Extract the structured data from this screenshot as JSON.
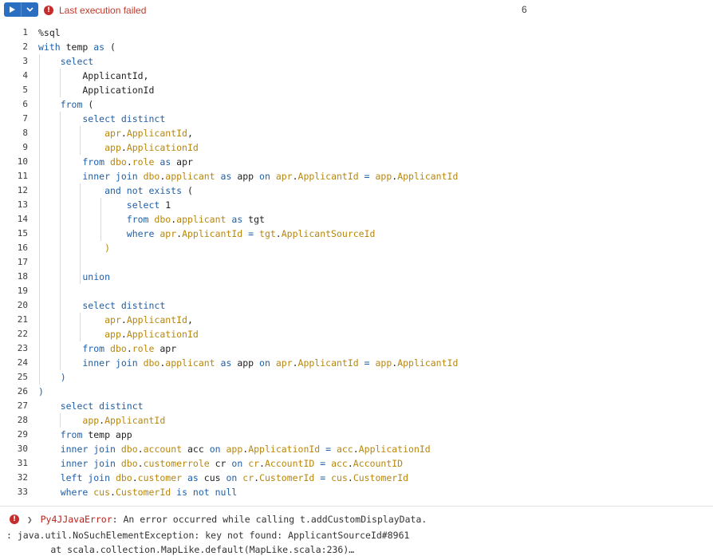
{
  "toolbar": {
    "status_text": "Last execution failed",
    "cell_number": "6"
  },
  "code_lines": [
    [
      {
        "t": "%sql",
        "c": ""
      }
    ],
    [
      {
        "t": "with",
        "c": "kw"
      },
      {
        "t": " temp ",
        "c": ""
      },
      {
        "t": "as",
        "c": "kw"
      },
      {
        "t": " (",
        "c": ""
      }
    ],
    [
      {
        "t": "    select",
        "c": "kw"
      }
    ],
    [
      {
        "t": "        ApplicantId,",
        "c": ""
      }
    ],
    [
      {
        "t": "        ApplicationId",
        "c": ""
      }
    ],
    [
      {
        "t": "    from",
        "c": "kw"
      },
      {
        "t": " (",
        "c": ""
      }
    ],
    [
      {
        "t": "        select distinct",
        "c": "kw"
      }
    ],
    [
      {
        "t": "            ",
        "c": ""
      },
      {
        "t": "apr",
        "c": "id"
      },
      {
        "t": ".",
        "c": ""
      },
      {
        "t": "ApplicantId",
        "c": "id"
      },
      {
        "t": ",",
        "c": ""
      }
    ],
    [
      {
        "t": "            ",
        "c": ""
      },
      {
        "t": "app",
        "c": "id"
      },
      {
        "t": ".",
        "c": ""
      },
      {
        "t": "ApplicationId",
        "c": "id"
      }
    ],
    [
      {
        "t": "        from",
        "c": "kw"
      },
      {
        "t": " ",
        "c": ""
      },
      {
        "t": "dbo",
        "c": "id"
      },
      {
        "t": ".",
        "c": ""
      },
      {
        "t": "role",
        "c": "id"
      },
      {
        "t": " ",
        "c": ""
      },
      {
        "t": "as",
        "c": "kw"
      },
      {
        "t": " apr",
        "c": ""
      }
    ],
    [
      {
        "t": "        inner join",
        "c": "kw"
      },
      {
        "t": " ",
        "c": ""
      },
      {
        "t": "dbo",
        "c": "id"
      },
      {
        "t": ".",
        "c": ""
      },
      {
        "t": "applicant",
        "c": "id"
      },
      {
        "t": " ",
        "c": ""
      },
      {
        "t": "as",
        "c": "kw"
      },
      {
        "t": " app ",
        "c": ""
      },
      {
        "t": "on",
        "c": "kw"
      },
      {
        "t": " ",
        "c": ""
      },
      {
        "t": "apr",
        "c": "id"
      },
      {
        "t": ".",
        "c": ""
      },
      {
        "t": "ApplicantId",
        "c": "id"
      },
      {
        "t": " = ",
        "c": "op"
      },
      {
        "t": "app",
        "c": "id"
      },
      {
        "t": ".",
        "c": ""
      },
      {
        "t": "ApplicantId",
        "c": "id"
      }
    ],
    [
      {
        "t": "            and not exists",
        "c": "kw"
      },
      {
        "t": " (",
        "c": ""
      }
    ],
    [
      {
        "t": "                select",
        "c": "kw"
      },
      {
        "t": " 1",
        "c": ""
      }
    ],
    [
      {
        "t": "                from",
        "c": "kw"
      },
      {
        "t": " ",
        "c": ""
      },
      {
        "t": "dbo",
        "c": "id"
      },
      {
        "t": ".",
        "c": ""
      },
      {
        "t": "applicant",
        "c": "id"
      },
      {
        "t": " ",
        "c": ""
      },
      {
        "t": "as",
        "c": "kw"
      },
      {
        "t": " tgt",
        "c": ""
      }
    ],
    [
      {
        "t": "                where",
        "c": "kw"
      },
      {
        "t": " ",
        "c": ""
      },
      {
        "t": "apr",
        "c": "id"
      },
      {
        "t": ".",
        "c": ""
      },
      {
        "t": "ApplicantId",
        "c": "id"
      },
      {
        "t": " = ",
        "c": "op"
      },
      {
        "t": "tgt",
        "c": "id"
      },
      {
        "t": ".",
        "c": ""
      },
      {
        "t": "ApplicantSourceId",
        "c": "id"
      }
    ],
    [
      {
        "t": "            )",
        "c": "id"
      }
    ],
    [],
    [
      {
        "t": "        union",
        "c": "kw"
      }
    ],
    [],
    [
      {
        "t": "        select distinct",
        "c": "kw"
      }
    ],
    [
      {
        "t": "            ",
        "c": ""
      },
      {
        "t": "apr",
        "c": "id"
      },
      {
        "t": ".",
        "c": ""
      },
      {
        "t": "ApplicantId",
        "c": "id"
      },
      {
        "t": ",",
        "c": ""
      }
    ],
    [
      {
        "t": "            ",
        "c": ""
      },
      {
        "t": "app",
        "c": "id"
      },
      {
        "t": ".",
        "c": ""
      },
      {
        "t": "ApplicationId",
        "c": "id"
      }
    ],
    [
      {
        "t": "        from",
        "c": "kw"
      },
      {
        "t": " ",
        "c": ""
      },
      {
        "t": "dbo",
        "c": "id"
      },
      {
        "t": ".",
        "c": ""
      },
      {
        "t": "role",
        "c": "id"
      },
      {
        "t": " apr",
        "c": ""
      }
    ],
    [
      {
        "t": "        inner join",
        "c": "kw"
      },
      {
        "t": " ",
        "c": ""
      },
      {
        "t": "dbo",
        "c": "id"
      },
      {
        "t": ".",
        "c": ""
      },
      {
        "t": "applicant",
        "c": "id"
      },
      {
        "t": " ",
        "c": ""
      },
      {
        "t": "as",
        "c": "kw"
      },
      {
        "t": " app ",
        "c": ""
      },
      {
        "t": "on",
        "c": "kw"
      },
      {
        "t": " ",
        "c": ""
      },
      {
        "t": "apr",
        "c": "id"
      },
      {
        "t": ".",
        "c": ""
      },
      {
        "t": "ApplicantId",
        "c": "id"
      },
      {
        "t": " = ",
        "c": "op"
      },
      {
        "t": "app",
        "c": "id"
      },
      {
        "t": ".",
        "c": ""
      },
      {
        "t": "ApplicantId",
        "c": "id"
      }
    ],
    [
      {
        "t": "    )",
        "c": "kw"
      }
    ],
    [
      {
        "t": ")",
        "c": "kw"
      }
    ],
    [
      {
        "t": "    select distinct",
        "c": "kw"
      }
    ],
    [
      {
        "t": "        ",
        "c": ""
      },
      {
        "t": "app",
        "c": "id"
      },
      {
        "t": ".",
        "c": ""
      },
      {
        "t": "ApplicantId",
        "c": "id"
      }
    ],
    [
      {
        "t": "    from",
        "c": "kw"
      },
      {
        "t": " temp app",
        "c": ""
      }
    ],
    [
      {
        "t": "    inner join",
        "c": "kw"
      },
      {
        "t": " ",
        "c": ""
      },
      {
        "t": "dbo",
        "c": "id"
      },
      {
        "t": ".",
        "c": ""
      },
      {
        "t": "account",
        "c": "id"
      },
      {
        "t": " acc ",
        "c": ""
      },
      {
        "t": "on",
        "c": "kw"
      },
      {
        "t": " ",
        "c": ""
      },
      {
        "t": "app",
        "c": "id"
      },
      {
        "t": ".",
        "c": ""
      },
      {
        "t": "ApplicationId",
        "c": "id"
      },
      {
        "t": " = ",
        "c": "op"
      },
      {
        "t": "acc",
        "c": "id"
      },
      {
        "t": ".",
        "c": ""
      },
      {
        "t": "ApplicationId",
        "c": "id"
      }
    ],
    [
      {
        "t": "    inner join",
        "c": "kw"
      },
      {
        "t": " ",
        "c": ""
      },
      {
        "t": "dbo",
        "c": "id"
      },
      {
        "t": ".",
        "c": ""
      },
      {
        "t": "customerrole",
        "c": "id"
      },
      {
        "t": " cr ",
        "c": ""
      },
      {
        "t": "on",
        "c": "kw"
      },
      {
        "t": " ",
        "c": ""
      },
      {
        "t": "cr",
        "c": "id"
      },
      {
        "t": ".",
        "c": ""
      },
      {
        "t": "AccountID",
        "c": "id"
      },
      {
        "t": " = ",
        "c": "op"
      },
      {
        "t": "acc",
        "c": "id"
      },
      {
        "t": ".",
        "c": ""
      },
      {
        "t": "AccountID",
        "c": "id"
      }
    ],
    [
      {
        "t": "    left join",
        "c": "kw"
      },
      {
        "t": " ",
        "c": ""
      },
      {
        "t": "dbo",
        "c": "id"
      },
      {
        "t": ".",
        "c": ""
      },
      {
        "t": "customer",
        "c": "id"
      },
      {
        "t": " ",
        "c": ""
      },
      {
        "t": "as",
        "c": "kw"
      },
      {
        "t": " cus ",
        "c": ""
      },
      {
        "t": "on",
        "c": "kw"
      },
      {
        "t": " ",
        "c": ""
      },
      {
        "t": "cr",
        "c": "id"
      },
      {
        "t": ".",
        "c": ""
      },
      {
        "t": "CustomerId",
        "c": "id"
      },
      {
        "t": " = ",
        "c": "op"
      },
      {
        "t": "cus",
        "c": "id"
      },
      {
        "t": ".",
        "c": ""
      },
      {
        "t": "CustomerId",
        "c": "id"
      }
    ],
    [
      {
        "t": "    where",
        "c": "kw"
      },
      {
        "t": " ",
        "c": ""
      },
      {
        "t": "cus",
        "c": "id"
      },
      {
        "t": ".",
        "c": ""
      },
      {
        "t": "CustomerId",
        "c": "id"
      },
      {
        "t": " ",
        "c": ""
      },
      {
        "t": "is not null",
        "c": "kw"
      }
    ]
  ],
  "output": {
    "error_name": "Py4JJavaError",
    "error_message": ": An error occurred while calling t.addCustomDisplayData.",
    "trace_line_1": ": java.util.NoSuchElementException: key not found: ApplicantSourceId#8961",
    "trace_line_2": "        at scala.collection.MapLike.default(MapLike.scala:236)…"
  }
}
